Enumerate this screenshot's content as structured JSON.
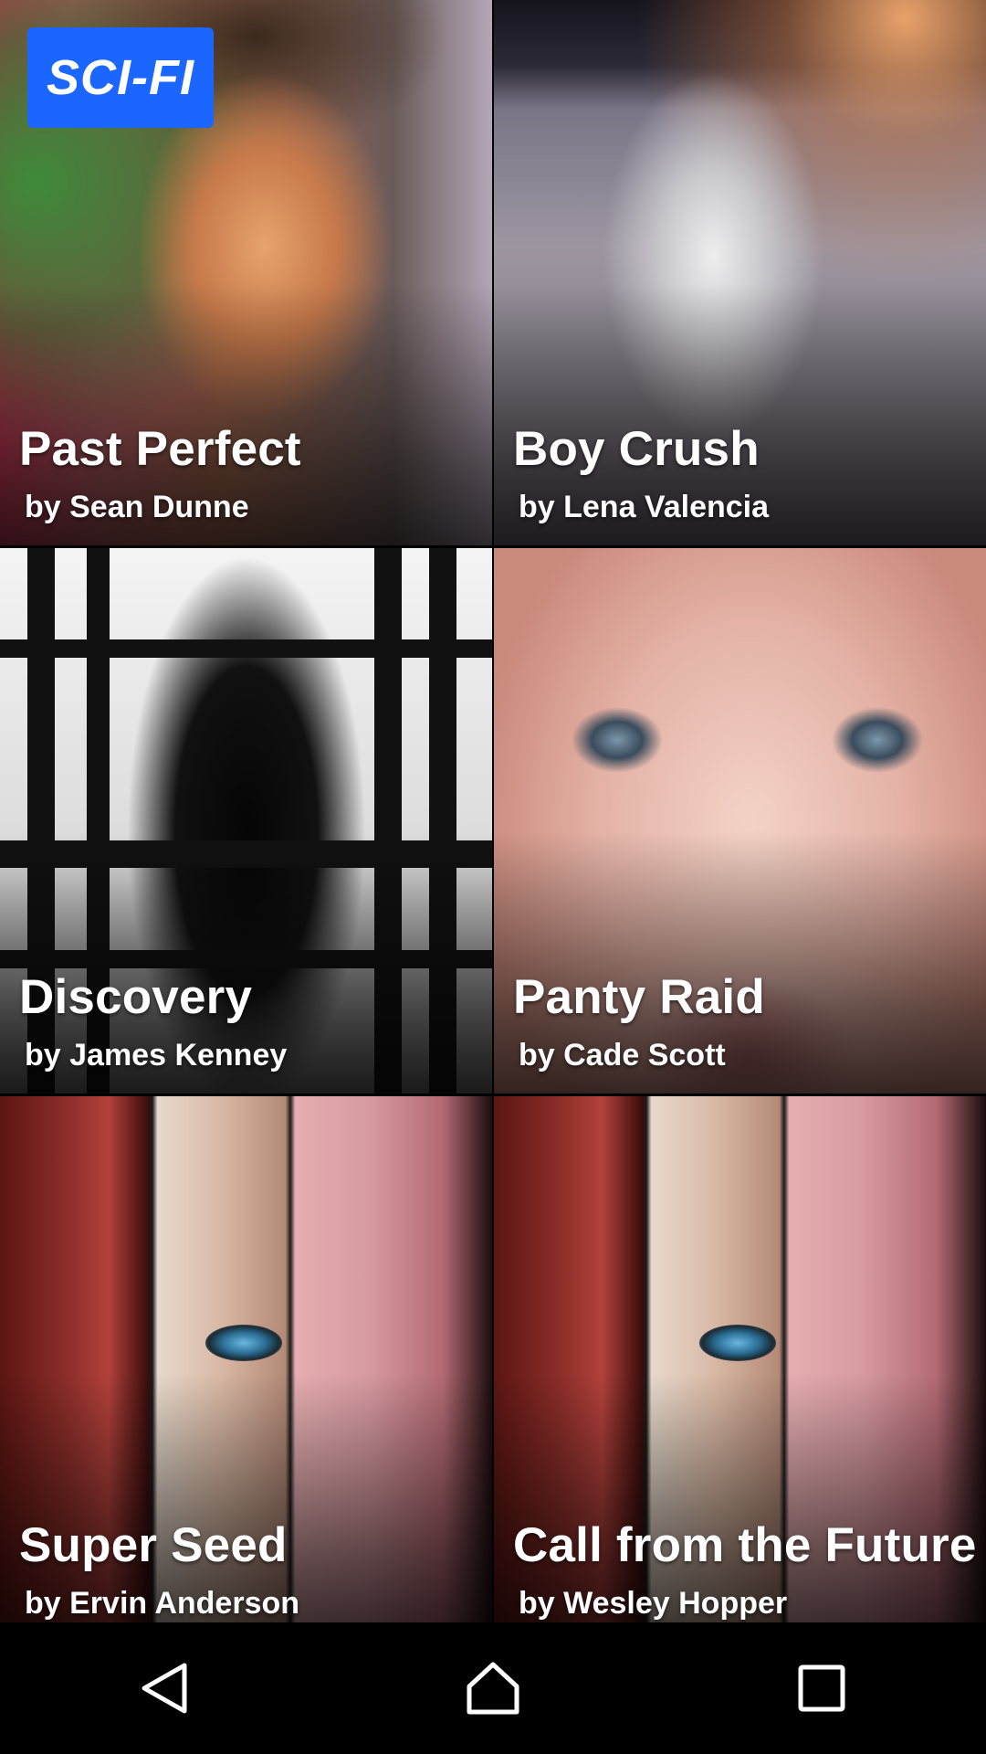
{
  "genre_badge": "SCI-FI",
  "stories": [
    {
      "title": "Past Perfect",
      "author": "by Sean Dunne"
    },
    {
      "title": "Boy Crush",
      "author": "by Lena Valencia"
    },
    {
      "title": "Discovery",
      "author": "by James Kenney"
    },
    {
      "title": "Panty Raid",
      "author": "by Cade Scott"
    },
    {
      "title": "Super Seed",
      "author": "by Ervin Anderson"
    },
    {
      "title": "Call from the Future",
      "author": "by Wesley Hopper"
    }
  ],
  "navbar": {
    "icons": [
      "back-icon",
      "home-icon",
      "recents-icon"
    ]
  }
}
